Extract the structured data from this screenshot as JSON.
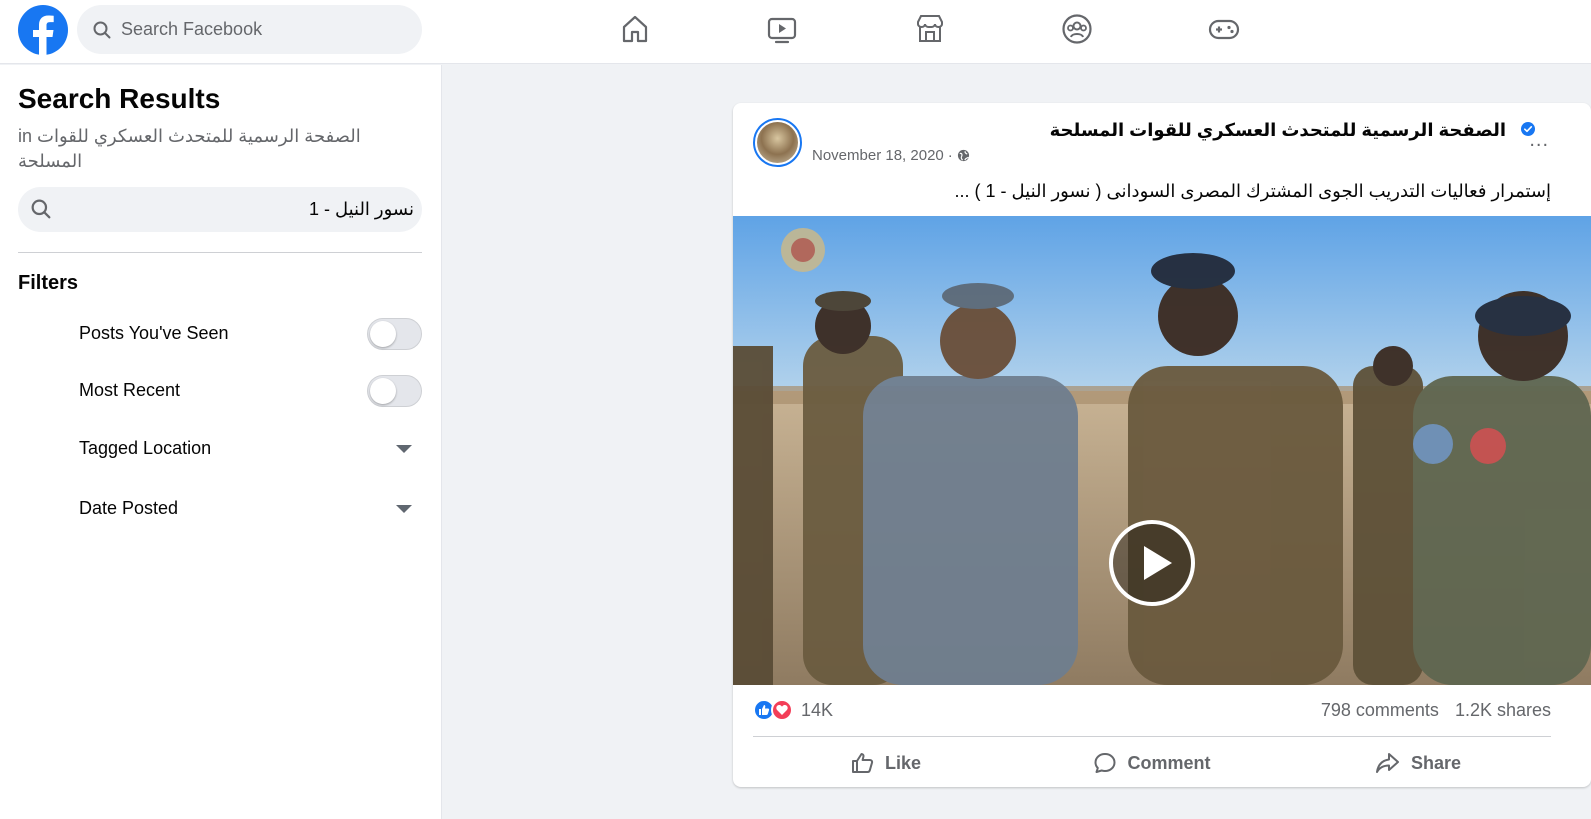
{
  "app": {
    "name": "Facebook"
  },
  "topbar": {
    "search_placeholder": "Search Facebook",
    "nav": [
      "home-icon",
      "watch-icon",
      "marketplace-icon",
      "groups-icon",
      "gaming-icon"
    ]
  },
  "sidebar": {
    "title": "Search Results",
    "in_prefix": "in",
    "in_page": "الصفحة الرسمية للمتحدث العسكري للقوات المسلحة",
    "query": "نسور النيل - 1",
    "filters_title": "Filters",
    "filters": [
      {
        "label": "Posts You've Seen",
        "type": "toggle",
        "on": false
      },
      {
        "label": "Most Recent",
        "type": "toggle",
        "on": false
      },
      {
        "label": "Tagged Location",
        "type": "dropdown"
      },
      {
        "label": "Date Posted",
        "type": "dropdown"
      }
    ]
  },
  "post": {
    "page_name": "الصفحة الرسمية للمتحدث العسكري للقوات المسلحة",
    "verified": true,
    "date": "November 18, 2020",
    "date_separator": "·",
    "audience_icon": "globe-icon",
    "text": "إستمرار فعاليات التدريب الجوى المشترك المصرى السودانى ( نسور النيل - 1 ) ...",
    "media_type": "video",
    "reactions": [
      "like",
      "love"
    ],
    "reaction_count": "14K",
    "comments": "798 comments",
    "shares": "1.2K shares",
    "actions": {
      "like": "Like",
      "comment": "Comment",
      "share": "Share"
    },
    "more": "..."
  },
  "colors": {
    "brand": "#1877f2",
    "love": "#f33e58",
    "secondary_text": "#65676b"
  }
}
